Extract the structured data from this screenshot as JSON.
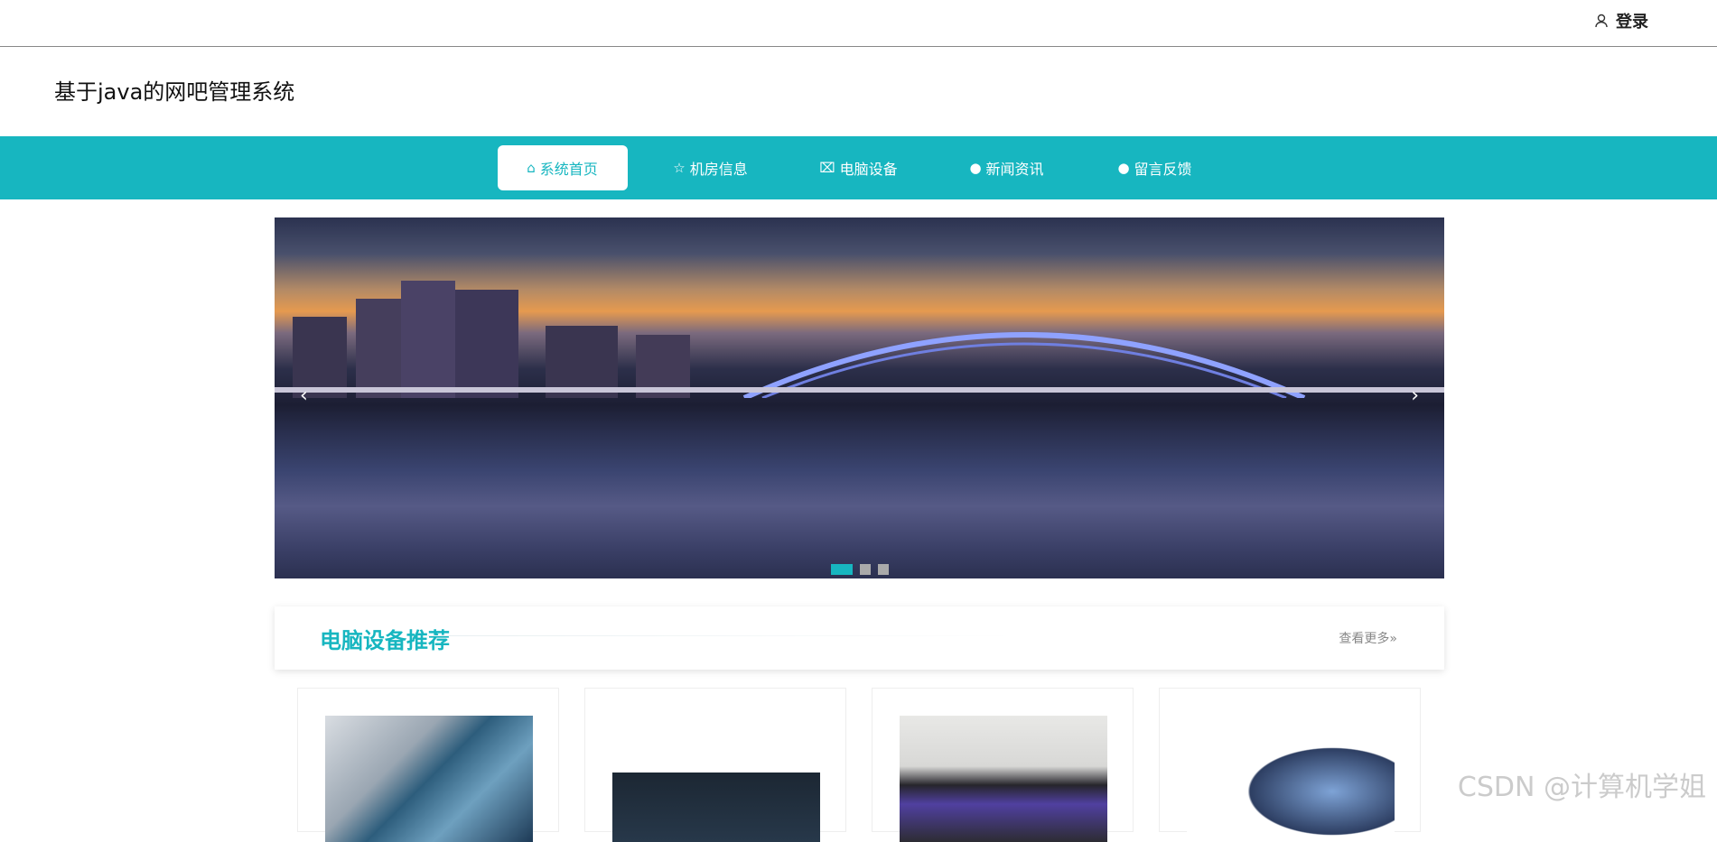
{
  "topbar": {
    "login_label": "登录"
  },
  "header": {
    "site_title": "基于java的网吧管理系统"
  },
  "nav": {
    "items": [
      {
        "label": "系统首页",
        "icon": "home-icon",
        "active": true
      },
      {
        "label": "机房信息",
        "icon": "star-icon",
        "active": false
      },
      {
        "label": "电脑设备",
        "icon": "bag-icon",
        "active": false
      },
      {
        "label": "新闻资讯",
        "icon": "alert-icon",
        "active": false
      },
      {
        "label": "留言反馈",
        "icon": "question-icon",
        "active": false
      }
    ]
  },
  "banner": {
    "slide_count": 3,
    "active_slide": 1
  },
  "section": {
    "title": "电脑设备推荐",
    "more_label": "查看更多»"
  },
  "watermark": {
    "text": "CSDN @计算机学姐"
  },
  "colors": {
    "accent": "#17b6c0"
  }
}
